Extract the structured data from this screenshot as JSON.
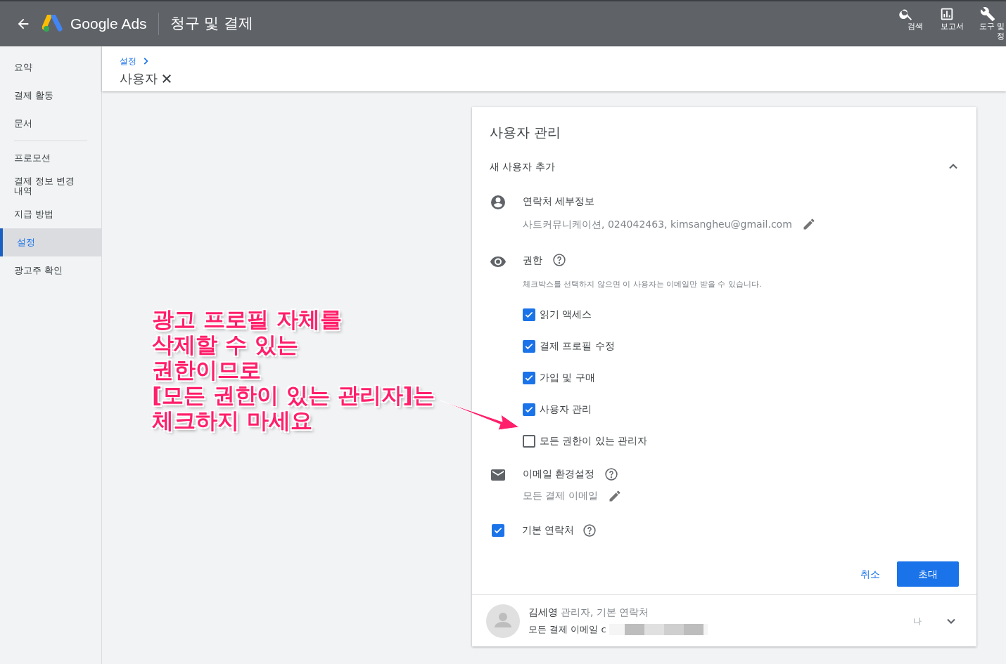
{
  "header": {
    "brand": "Google Ads",
    "title": "청구 및 결제",
    "actions": [
      {
        "kind": "search",
        "lines": [
          "검색"
        ]
      },
      {
        "kind": "report",
        "lines": [
          "보고서"
        ]
      },
      {
        "kind": "tools",
        "lines": [
          "도구 및",
          "정"
        ]
      }
    ]
  },
  "sidebar": {
    "items": [
      {
        "label": "요약",
        "selected": false,
        "divider_after": false
      },
      {
        "label": "결제 활동",
        "selected": false,
        "divider_after": false
      },
      {
        "label": "문서",
        "selected": false,
        "divider_after": true
      },
      {
        "label": "프로모션",
        "selected": false,
        "divider_after": false
      },
      {
        "label": "결제 정보 변경 내역",
        "selected": false,
        "divider_after": false
      },
      {
        "label": "지급 방법",
        "selected": false,
        "divider_after": false
      },
      {
        "label": "설정",
        "selected": true,
        "divider_after": false
      },
      {
        "label": "광고주 확인",
        "selected": false,
        "divider_after": false
      }
    ]
  },
  "breadcrumb": {
    "parent": "설정",
    "current": "사용자"
  },
  "card": {
    "title": "사용자 관리",
    "section_title": "새 사용자 추가",
    "expanded": true,
    "contact": {
      "label": "연락처 세부정보",
      "value": "사트커뮤니케이션, 024042463, kimsangheu@gmail.com"
    },
    "permissions": {
      "label": "권한",
      "hint": "체크박스를 선택하지 않으면 이 사용자는 이메일만 받을 수 있습니다.",
      "options": [
        {
          "label": "읽기 액세스",
          "checked": true
        },
        {
          "label": "결제 프로필 수정",
          "checked": true
        },
        {
          "label": "가입 및 구매",
          "checked": true
        },
        {
          "label": "사용자 관리",
          "checked": true
        },
        {
          "label": "모든 권한이 있는 관리자",
          "checked": false
        }
      ]
    },
    "email": {
      "label": "이메일 환경설정",
      "value": "모든 결제 이메일"
    },
    "primary_contact": {
      "label": "기본 연락처",
      "checked": true
    },
    "buttons": {
      "cancel": "취소",
      "invite": "초대"
    },
    "user": {
      "name": "김세영",
      "roles": "관리자, 기본 연락처",
      "emails": "모든 결제 이메일 c",
      "tag": "나"
    }
  },
  "annotation": {
    "lines": [
      "광고 프로필 자체를",
      "삭제할 수 있는",
      "권한이므로",
      "[모든 권한이 있는 관리자]는",
      "체크하지 마세요"
    ]
  }
}
